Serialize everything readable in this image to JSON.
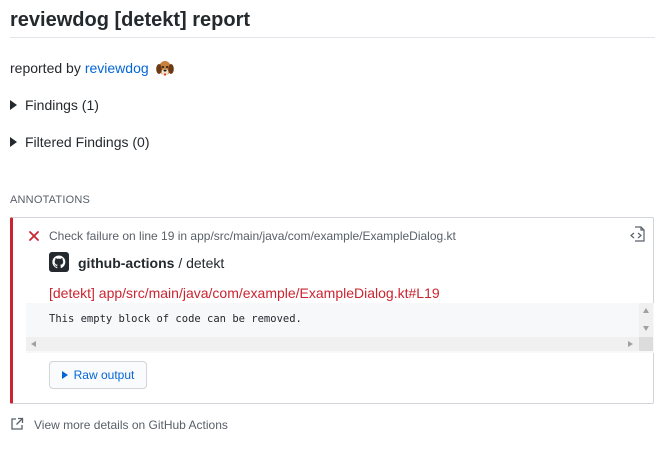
{
  "page": {
    "title": "reviewdog [detekt] report",
    "reported_by_label": "reported by",
    "reported_by_link": "reviewdog"
  },
  "sections": [
    {
      "label": "Findings (1)"
    },
    {
      "label": "Filtered Findings (0)"
    }
  ],
  "annotations": {
    "heading": "ANNOTATIONS",
    "item": {
      "status": "failure",
      "check_text": "Check failure on line 19 in app/src/main/java/com/example/ExampleDialog.kt",
      "app_name": "github-actions",
      "app_separator": "/",
      "check_name": "detekt",
      "file_link": "[detekt] app/src/main/java/com/example/ExampleDialog.kt#L19",
      "message": "This empty block of code can be removed.",
      "raw_output_label": "Raw output"
    }
  },
  "footer": {
    "view_more": "View more details on GitHub Actions"
  },
  "colors": {
    "failure_red": "#cb2431",
    "link_blue": "#0366d6",
    "muted_gray": "#586069"
  }
}
